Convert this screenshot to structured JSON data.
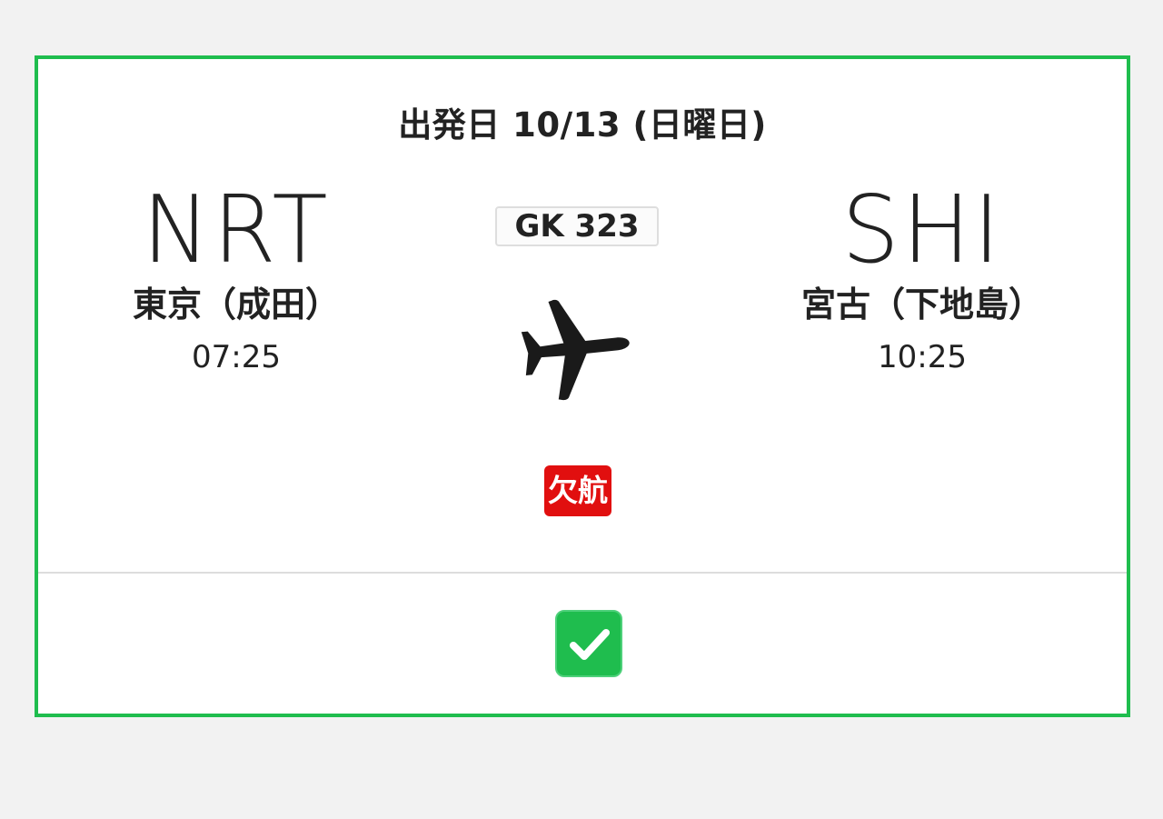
{
  "flight": {
    "date_label": "出発日 10/13 (日曜日)",
    "flight_number": "GK 323",
    "status": "欠航",
    "departure": {
      "code": "NRT",
      "city": "東京（成田）",
      "time": "07:25"
    },
    "arrival": {
      "code": "SHI",
      "city": "宮古（下地島）",
      "time": "10:25"
    }
  },
  "selection": {
    "checked": true,
    "icon": "checkmark-icon"
  },
  "colors": {
    "accent": "#1fbd4e",
    "status_cancelled": "#e10f0f",
    "text": "#222222",
    "background": "#f2f2f2"
  }
}
